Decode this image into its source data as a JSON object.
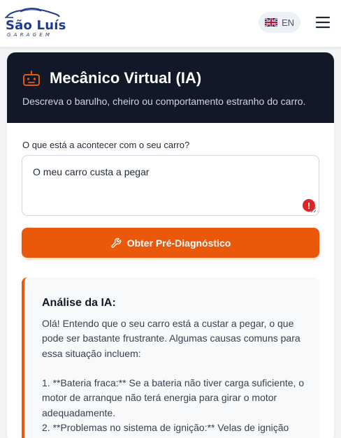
{
  "header": {
    "logo_name": "São Luís",
    "logo_sub": "GARAGEM",
    "language": {
      "label": "EN",
      "icon": "uk-flag-icon"
    },
    "menu_icon": "hamburger-menu-icon"
  },
  "card": {
    "title": "Mecânico Virtual (IA)",
    "subtitle": "Descreva o barulho, cheiro ou comportamento estranho do carro.",
    "icon": "robot-icon",
    "accent_color": "#ea580c",
    "header_bg": "#111827"
  },
  "form": {
    "question_label": "O que está a acontecer com o seu carro?",
    "input_value": "O meu carro custa a pegar",
    "error_icon": "!",
    "submit_label": "Obter Pré-Diagnóstico",
    "submit_icon": "wrench-icon"
  },
  "analysis": {
    "title": "Análise da IA:",
    "intro": "Olá! Entendo que o seu carro está a custar a pegar, o que pode ser bastante frustrante. Algumas causas comuns para essa situação incluem:",
    "item1": "1. **Bateria fraca:** Se a bateria não tiver carga suficiente, o motor de arranque não terá energia para girar o motor adequadamente.",
    "item2": "2. **Problemas no sistema de ignição:** Velas de ignição"
  }
}
